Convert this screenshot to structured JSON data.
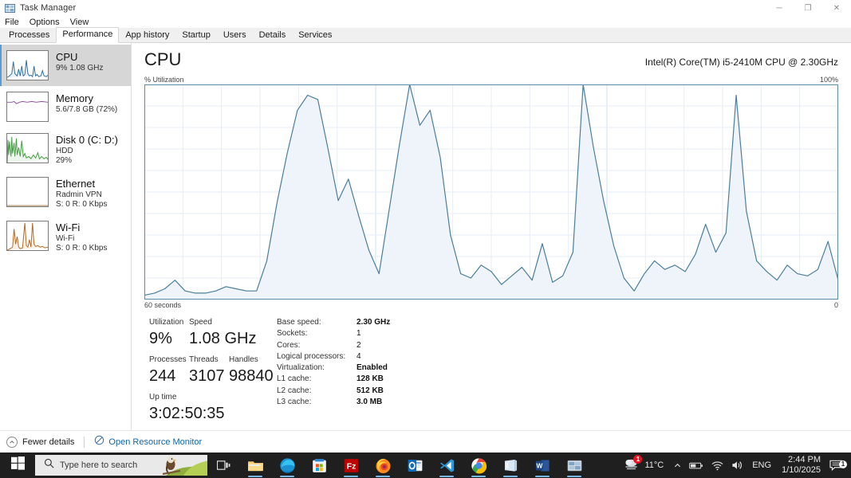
{
  "window": {
    "title": "Task Manager",
    "icon": "task-manager-icon",
    "minimize_label": "─",
    "restore_label": "❐",
    "close_label": "✕"
  },
  "menubar": {
    "items": [
      "File",
      "Options",
      "View"
    ]
  },
  "tabs": [
    {
      "label": "Processes",
      "active": false
    },
    {
      "label": "Performance",
      "active": true
    },
    {
      "label": "App history",
      "active": false
    },
    {
      "label": "Startup",
      "active": false
    },
    {
      "label": "Users",
      "active": false
    },
    {
      "label": "Details",
      "active": false
    },
    {
      "label": "Services",
      "active": false
    }
  ],
  "sidebar": {
    "items": [
      {
        "name": "CPU",
        "sub1": "9%  1.08 GHz",
        "sub2": "",
        "color": "#4a86a8",
        "selected": true
      },
      {
        "name": "Memory",
        "sub1": "5.6/7.8 GB (72%)",
        "sub2": "",
        "color": "#8b4f9f",
        "selected": false
      },
      {
        "name": "Disk 0 (C: D:)",
        "sub1": "HDD",
        "sub2": "29%",
        "color": "#3f9b3f",
        "selected": false
      },
      {
        "name": "Ethernet",
        "sub1": "Radmin VPN",
        "sub2": "S: 0 R: 0 Kbps",
        "color": "#9a6b2f",
        "selected": false
      },
      {
        "name": "Wi-Fi",
        "sub1": "Wi-Fi",
        "sub2": "S: 0 R: 0 Kbps",
        "color": "#b5651d",
        "selected": false
      }
    ]
  },
  "main": {
    "heading": "CPU",
    "model": "Intel(R) Core(TM) i5-2410M CPU @ 2.30GHz",
    "axis_top_left": "% Utilization",
    "axis_top_right": "100%",
    "axis_bottom_left": "60 seconds",
    "axis_bottom_right": "0"
  },
  "chart_data": {
    "type": "area",
    "title": "CPU % Utilization",
    "xlabel": "60 seconds",
    "ylabel": "% Utilization",
    "ylim": [
      0,
      100
    ],
    "xlim": [
      0,
      60
    ],
    "grid": true,
    "line_color": "#4a7e9b",
    "fill_color": "#eef4fa",
    "legend": "none",
    "values": [
      2,
      3,
      5,
      9,
      4,
      3,
      3,
      4,
      6,
      5,
      4,
      4,
      18,
      45,
      68,
      88,
      95,
      93,
      70,
      46,
      56,
      39,
      23,
      12,
      42,
      72,
      100,
      81,
      88,
      66,
      30,
      12,
      10,
      16,
      13,
      7,
      11,
      15,
      9,
      26,
      8,
      11,
      22,
      100,
      71,
      46,
      25,
      10,
      4,
      12,
      18,
      14,
      16,
      13,
      21,
      35,
      22,
      31,
      95,
      41,
      18,
      13,
      9,
      16,
      12,
      11,
      14,
      27,
      9
    ]
  },
  "stats": {
    "left": [
      {
        "label": "Utilization",
        "value": "9%"
      },
      {
        "label": "Speed",
        "value": "1.08 GHz"
      },
      {
        "label": "Processes",
        "value": "244"
      },
      {
        "label": "Threads",
        "value": "3107"
      },
      {
        "label": "Handles",
        "value": "98840"
      },
      {
        "label": "Up time",
        "value": "3:02:50:35"
      }
    ],
    "details": [
      {
        "key": "Base speed:",
        "value": "2.30 GHz",
        "bold": true
      },
      {
        "key": "Sockets:",
        "value": "1",
        "bold": false
      },
      {
        "key": "Cores:",
        "value": "2",
        "bold": false
      },
      {
        "key": "Logical processors:",
        "value": "4",
        "bold": false
      },
      {
        "key": "Virtualization:",
        "value": "Enabled",
        "bold": true
      },
      {
        "key": "L1 cache:",
        "value": "128 KB",
        "bold": true
      },
      {
        "key": "L2 cache:",
        "value": "512 KB",
        "bold": true
      },
      {
        "key": "L3 cache:",
        "value": "3.0 MB",
        "bold": true
      }
    ]
  },
  "footer": {
    "fewer_details": "Fewer details",
    "resource_monitor": "Open Resource Monitor",
    "chevron_icon": "chevron-up-icon",
    "resource_icon": "resource-monitor-icon"
  },
  "taskbar": {
    "start_icon": "windows-start-icon",
    "search_placeholder": "Type here to search",
    "search_icon": "search-icon",
    "task_view_icon": "task-view-icon",
    "apps": [
      {
        "name": "file-explorer",
        "running": true
      },
      {
        "name": "microsoft-edge",
        "running": true
      },
      {
        "name": "microsoft-store",
        "running": false
      },
      {
        "name": "filezilla",
        "running": true
      },
      {
        "name": "firefox",
        "running": true
      },
      {
        "name": "outlook",
        "running": false
      },
      {
        "name": "visual-studio-code",
        "running": true
      },
      {
        "name": "google-chrome",
        "running": true
      },
      {
        "name": "onenote",
        "running": true
      },
      {
        "name": "microsoft-word",
        "running": true
      },
      {
        "name": "task-manager",
        "running": true
      }
    ],
    "weather": {
      "temperature": "11°C",
      "icon": "fog-weather-icon",
      "badge": "1"
    },
    "tray": {
      "chevron": "show-hidden-icons-chevron",
      "battery_icon": "battery-icon",
      "network_icon": "wifi-icon",
      "volume_icon": "volume-icon",
      "language": "ENG"
    },
    "clock": {
      "time": "2:44 PM",
      "date": "1/10/2025"
    },
    "notification": {
      "icon": "action-center-icon",
      "badge": "1"
    }
  }
}
